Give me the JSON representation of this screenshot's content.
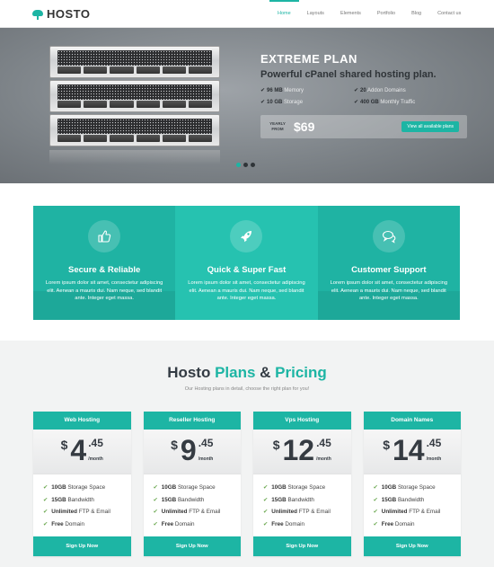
{
  "brand": {
    "name": "HOSTO",
    "accent": "#1db5a4"
  },
  "nav": [
    {
      "label": "Home",
      "active": true
    },
    {
      "label": "Layouts",
      "active": false
    },
    {
      "label": "Elements",
      "active": false
    },
    {
      "label": "Portfolio",
      "active": false
    },
    {
      "label": "Blog",
      "active": false
    },
    {
      "label": "Contact us",
      "active": false
    }
  ],
  "hero": {
    "title": "EXTREME PLAN",
    "subtitle": "Powerful cPanel shared hosting plan.",
    "features": [
      {
        "value": "96 MB",
        "unit": " Memory"
      },
      {
        "value": "20",
        "unit": " Addon Domains"
      },
      {
        "value": "10 GB",
        "unit": " Storage"
      },
      {
        "value": "400 GB",
        "unit": " Monthly Traffic"
      }
    ],
    "price_prefix_1": "YEARLY",
    "price_prefix_2": "FROM",
    "price": "$69",
    "cta": "View all available plans",
    "slides": 3,
    "active_slide": 1
  },
  "features": [
    {
      "icon": "thumbs-up-icon",
      "title": "Secure & Reliable",
      "text": "Lorem ipsum dolor sit amet, consectetur adipiscing elit. Aenean a mauris dui. Nam neque, sed blandit ante. Integer eget massa."
    },
    {
      "icon": "rocket-icon",
      "title": "Quick & Super Fast",
      "text": "Lorem ipsum dolor sit amet, consectetur adipiscing elit. Aenean a mauris dui. Nam neque, sed blandit ante. Integer eget massa."
    },
    {
      "icon": "chat-icon",
      "title": "Customer Support",
      "text": "Lorem ipsum dolor sit amet, consectetur adipiscing elit. Aenean a mauris dui. Nam neque, sed blandit ante. Integer eget massa."
    }
  ],
  "pricing": {
    "title_1": "Hosto ",
    "title_2": "Plans",
    "title_3": " & ",
    "title_4": "Pricing",
    "subtitle": "Our Hosting plans in detail, choose the right plan for you!",
    "plans": [
      {
        "name": "Web Hosting",
        "currency": "$",
        "int": "4",
        "dec": ".45",
        "per": "/month",
        "items": [
          {
            "strong": "10GB",
            "rest": " Storage Space"
          },
          {
            "strong": "15GB",
            "rest": " Bandwidth"
          },
          {
            "strong": "Unlimited",
            "rest": " FTP & Email"
          },
          {
            "strong": "Free",
            "rest": " Domain"
          }
        ],
        "button": "Sign Up Now"
      },
      {
        "name": "Reseller Hosting",
        "currency": "$",
        "int": "9",
        "dec": ".45",
        "per": "/month",
        "items": [
          {
            "strong": "10GB",
            "rest": " Storage Space"
          },
          {
            "strong": "15GB",
            "rest": " Bandwidth"
          },
          {
            "strong": "Unlimited",
            "rest": " FTP & Email"
          },
          {
            "strong": "Free",
            "rest": " Domain"
          }
        ],
        "button": "Sign Up Now"
      },
      {
        "name": "Vps Hosting",
        "currency": "$",
        "int": "12",
        "dec": ".45",
        "per": "/month",
        "items": [
          {
            "strong": "10GB",
            "rest": " Storage Space"
          },
          {
            "strong": "15GB",
            "rest": " Bandwidth"
          },
          {
            "strong": "Unlimited",
            "rest": " FTP & Email"
          },
          {
            "strong": "Free",
            "rest": " Domain"
          }
        ],
        "button": "Sign Up Now"
      },
      {
        "name": "Domain Names",
        "currency": "$",
        "int": "14",
        "dec": ".45",
        "per": "/month",
        "items": [
          {
            "strong": "10GB",
            "rest": " Storage Space"
          },
          {
            "strong": "15GB",
            "rest": " Bandwidth"
          },
          {
            "strong": "Unlimited",
            "rest": " FTP & Email"
          },
          {
            "strong": "Free",
            "rest": " Domain"
          }
        ],
        "button": "Sign Up Now"
      }
    ]
  }
}
